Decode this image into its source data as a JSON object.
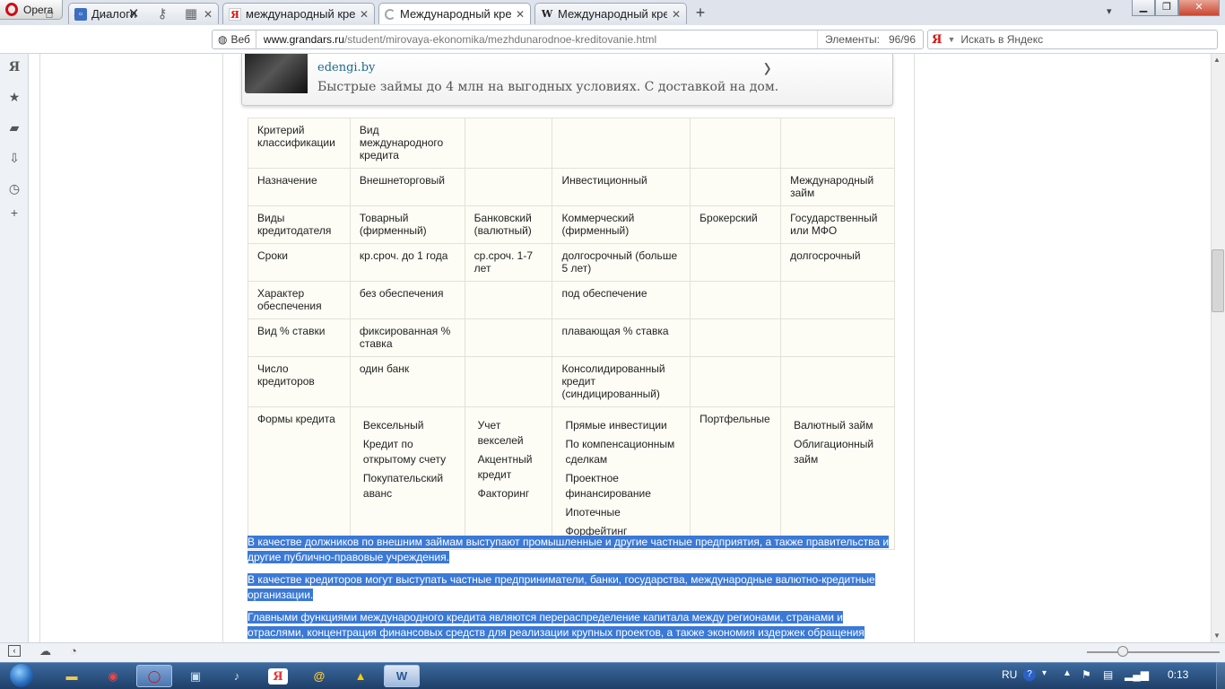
{
  "browser": {
    "menu_label": "Opera",
    "tabs": [
      {
        "label": "Диалоги",
        "icon": "dialog-icon"
      },
      {
        "label": "международный кред",
        "icon": "yandex-icon"
      },
      {
        "label": "Международный кред",
        "icon": "loading-icon"
      },
      {
        "label": "Международный кред",
        "icon": "wikipedia-icon"
      }
    ],
    "web_label": "Веб",
    "url_domain": "www.grandars.ru",
    "url_path": "/student/mirovaya-ekonomika/mezhdunarodnoe-kreditovanie.html",
    "elements_label": "Элементы:",
    "elements_value": "96/96",
    "search_placeholder": "Искать в Яндекс",
    "yandex_glyph": "Я"
  },
  "ad": {
    "domain": "edengi.by",
    "text": "Быстрые займы до 4 млн на выгодных условиях. С доставкой на дом."
  },
  "table": {
    "rows": [
      [
        "Критерий классификации",
        "Вид международного кредита",
        "",
        "",
        "",
        ""
      ],
      [
        "Назначение",
        "Внешнеторговый",
        "",
        "Инвестиционный",
        "",
        "Международный займ"
      ],
      [
        "Виды кредитодателя",
        "Товарный (фирменный)",
        "Банковский (валютный)",
        "Коммерческий (фирменный)",
        "Брокерский",
        "Государственный или МФО"
      ],
      [
        "Сроки",
        "кр.сроч. до 1 года",
        "ср.сроч. 1-7 лет",
        "долгосрочный (больше 5 лет)",
        "",
        "долгосрочный"
      ],
      [
        "Характер обеспечения",
        "без обеспечения",
        "",
        "под обеспечение",
        "",
        ""
      ],
      [
        "Вид % ставки",
        "фиксированная % ставка",
        "",
        "плавающая % ставка",
        "",
        ""
      ],
      [
        "Число кредиторов",
        "один банк",
        "",
        "Консолидированный кредит (синдицированный)",
        "",
        ""
      ]
    ],
    "forms_label": "Формы кредита",
    "forms": {
      "c1": [
        "Вексельный",
        "Кредит по открытому счету",
        "Покупательский аванс"
      ],
      "c2": [
        "Учет векселей",
        "Акцентный кредит",
        "Факторинг"
      ],
      "c3": [
        "Прямые инвестиции",
        "По компенсационным сделкам",
        "Проектное финансирование",
        "Ипотечные",
        "Форфейтинг"
      ],
      "c4": "Портфельные",
      "c5": [
        "Валютный займ",
        "Облигационный займ"
      ]
    }
  },
  "paragraphs": [
    "В качестве должников по внешним займам выступают промышленные и другие частные предприятия, а также правительства и другие публично-правовые учреждения.",
    "В качестве кредиторов могут выступать частные предприниматели, банки, государства, международные валютно-кредитные организации.",
    "Главными функциями международного кредита являются перераспределение капитала между регионами, странами и отраслями, концентрация финансовых средств для реализации крупных проектов, а также экономия издержек обращения"
  ],
  "taskbar": {
    "lang": "RU",
    "time": "0:13"
  },
  "colors": {
    "selection": "#3a79d6",
    "table_bg": "#fdfdf6",
    "taskbar": "#2a5182"
  }
}
